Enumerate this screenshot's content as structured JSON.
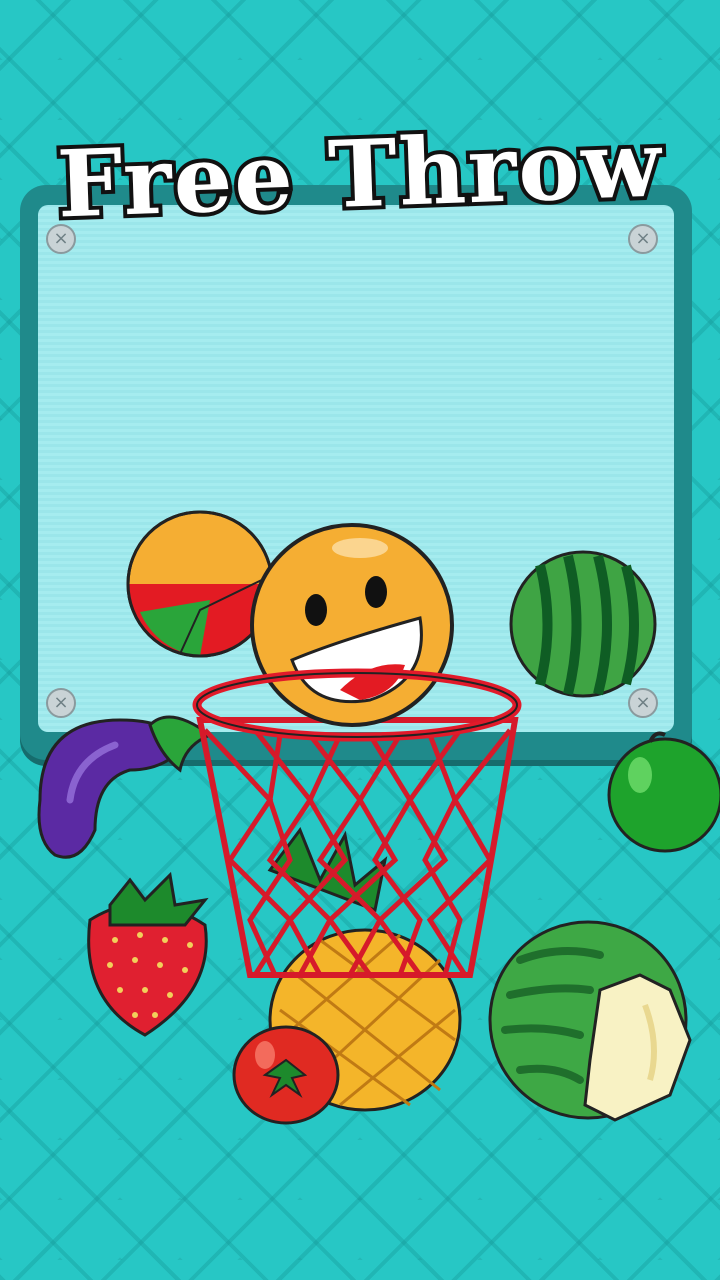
{
  "game": {
    "title": "Free Throw"
  },
  "colors": {
    "background": "#27c7c5",
    "board": "#1f8a8b",
    "board_panel": "#a5ecef",
    "hoop_red": "#e11a2a",
    "ball_orange": "#f5ae33"
  },
  "icons": {
    "screw": "screw-icon",
    "close_glyph": "×"
  }
}
